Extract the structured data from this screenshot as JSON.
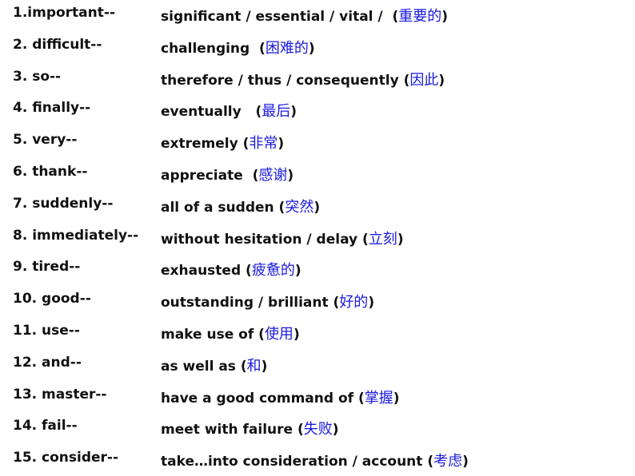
{
  "rows": [
    {
      "term": "1.important--",
      "en": "significant / essential / vital /  ",
      "cn": "重要的"
    },
    {
      "term": "2. difficult--",
      "en": "challenging  ",
      "cn": "困难的"
    },
    {
      "term": "3. so--",
      "en": "therefore / thus / consequently ",
      "cn": "因此"
    },
    {
      "term": "4. finally--",
      "en": "eventually   ",
      "cn": "最后"
    },
    {
      "term": "5. very--",
      "en": "extremely ",
      "cn": "非常"
    },
    {
      "term": "6. thank--",
      "en": "appreciate  ",
      "cn": "感谢"
    },
    {
      "term": "7. suddenly--",
      "en": "all of a sudden ",
      "cn": "突然"
    },
    {
      "term": "8. immediately--",
      "en": "without hesitation / delay ",
      "cn": "立刻"
    },
    {
      "term": "9. tired--",
      "en": "exhausted ",
      "cn": "疲惫的"
    },
    {
      "term": "10. good--",
      "en": "outstanding / brilliant ",
      "cn": "好的"
    },
    {
      "term": "11. use--",
      "en": "make use of ",
      "cn": "使用"
    },
    {
      "term": "12. and--",
      "en": "as well as ",
      "cn": "和"
    },
    {
      "term": "13. master--",
      "en": "have a good command of ",
      "cn": "掌握"
    },
    {
      "term": "14. fail--",
      "en": "meet with failure ",
      "cn": "失败"
    },
    {
      "term": "15. consider--",
      "en": "take…into consideration / account ",
      "cn": "考虑"
    }
  ],
  "colors": {
    "text": "#111111",
    "chinese": "#1a1adf"
  }
}
